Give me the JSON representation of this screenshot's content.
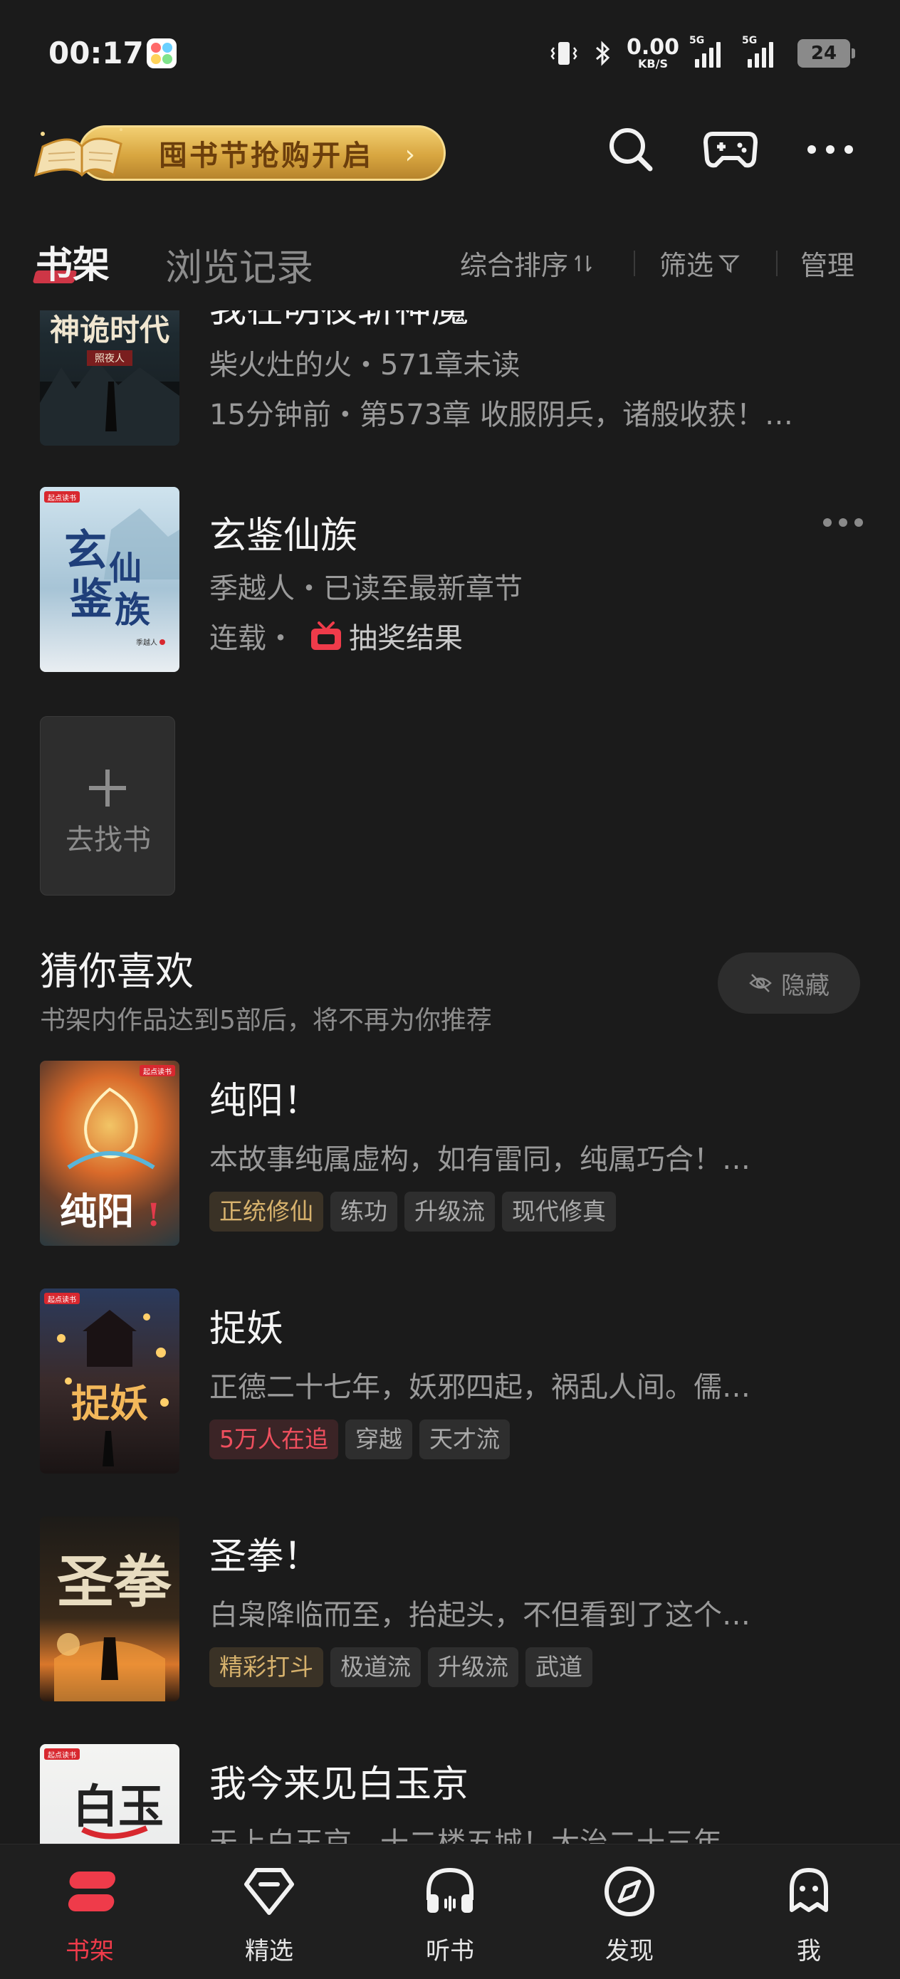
{
  "status_bar": {
    "time": "00:17",
    "net_speed_value": "0.00",
    "net_speed_unit": "KB/S",
    "signal_1_label": "5G",
    "signal_2_label": "5G",
    "battery": "24"
  },
  "header": {
    "promo_text": "囤书节抢购开启",
    "icons": [
      "search-icon",
      "gamepad-icon",
      "more-icon"
    ]
  },
  "tabs": {
    "shelf": "书架",
    "history": "浏览记录",
    "sort": "综合排序",
    "filter": "筛选",
    "manage": "管理"
  },
  "shelf_books": [
    {
      "title": "我在明夜斩神魔",
      "meta": "柴火灶的火・571章未读",
      "progress": "15分钟前・第573章 收服阴兵，诸般收获！…"
    },
    {
      "title": "玄鉴仙族",
      "meta": "季越人・已读至最新章节",
      "status": "连载・",
      "event": "抽奖结果"
    }
  ],
  "add_book": {
    "label": "去找书"
  },
  "recommend": {
    "title": "猜你喜欢",
    "subtitle": "书架内作品达到5部后，将不再为你推荐",
    "hide_label": "隐藏",
    "books": [
      {
        "title": "纯阳！",
        "desc": "本故事纯属虚构，如有雷同，纯属巧合！…",
        "tags": [
          "正统修仙",
          "练功",
          "升级流",
          "现代修真"
        ]
      },
      {
        "title": "捉妖",
        "desc": "正德二十七年，妖邪四起，祸乱人间。儒…",
        "tags": [
          "5万人在追",
          "穿越",
          "天才流"
        ]
      },
      {
        "title": "圣拳！",
        "desc": "白枭降临而至，抬起头，不但看到了这个…",
        "tags": [
          "精彩打斗",
          "极道流",
          "升级流",
          "武道"
        ]
      },
      {
        "title": "我今来见白玉京",
        "desc": "天上白玉京，十二楼五城！大治二十三年…"
      }
    ]
  },
  "bottom_nav": [
    "书架",
    "精选",
    "听书",
    "发现",
    "我"
  ],
  "colors": {
    "accent": "#ef3b4a",
    "gold": "#d7b26d",
    "background": "#1b1b1b"
  }
}
